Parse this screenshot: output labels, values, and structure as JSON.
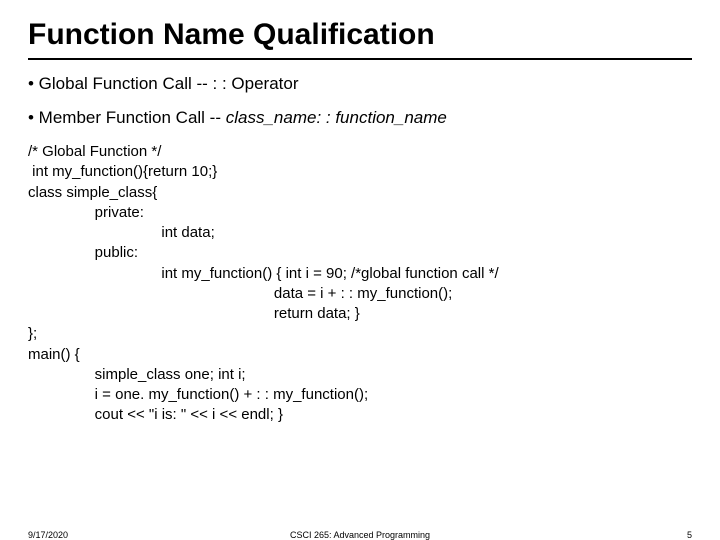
{
  "title": "Function Name Qualification",
  "bullets": {
    "b1_lead": "• Global Function Call -- : : Operator",
    "b2_lead": "• Member Function Call -- ",
    "b2_italic": "class_name: : function_name"
  },
  "code": "/* Global Function */\n int my_function(){return 10;}\nclass simple_class{\n                private:\n                                int data;\n                public:\n                                int my_function() { int i = 90; /*global function call */\n                                                           data = i + : : my_function();\n                                                           return data; }\n};\nmain() {\n                simple_class one; int i;\n                i = one. my_function() + : : my_function();\n                cout << \"i is: \" << i << endl; }",
  "footer": {
    "date": "9/17/2020",
    "course": "CSCI 265: Advanced Programming",
    "page": "5"
  }
}
